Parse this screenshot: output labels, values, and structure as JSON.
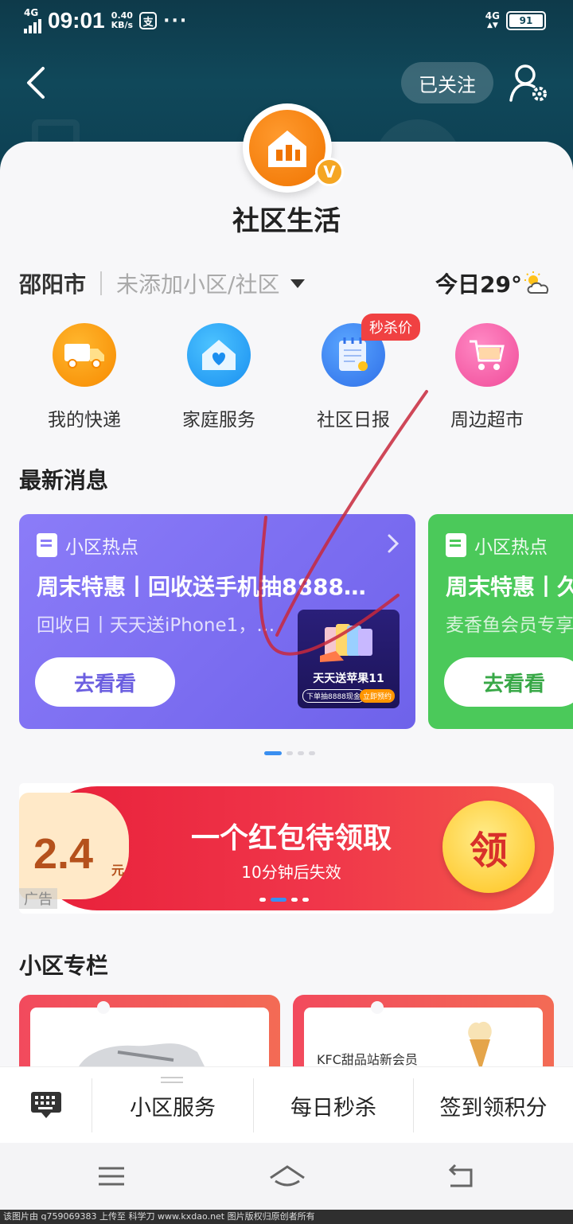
{
  "status_bar": {
    "network_left": "4G",
    "time": "09:01",
    "speed_value": "0.40",
    "speed_unit": "KB/s",
    "pay_icon_char": "支",
    "more": "···",
    "network_right": "4G",
    "battery": "91"
  },
  "header": {
    "follow_label": "已关注"
  },
  "profile": {
    "title": "社区生活"
  },
  "location": {
    "city": "邵阳市",
    "community_placeholder": "未添加小区/社区",
    "weather": "今日29°"
  },
  "services": [
    {
      "label": "我的快递",
      "icon": "truck-icon"
    },
    {
      "label": "家庭服务",
      "icon": "home-heart-icon"
    },
    {
      "label": "社区日报",
      "icon": "calendar-icon"
    },
    {
      "label": "周边超市",
      "icon": "shopping-cart-icon"
    }
  ],
  "badge": "秒杀价",
  "latest": {
    "section_title": "最新消息",
    "cards": [
      {
        "tag": "小区热点",
        "title": "周末特惠丨回收送手机抽8888…",
        "subtitle": "回收日丨天天送iPhone1，…",
        "button": "去看看",
        "promo_title": "天天送苹果11",
        "promo_note": "下单抽8888现金",
        "promo_cta": "立即预约"
      },
      {
        "tag": "小区热点",
        "title": "周末特惠丨久",
        "subtitle": "麦香鱼会员专享",
        "button": "去看看"
      }
    ]
  },
  "red_packet": {
    "amount": "2.4",
    "unit": "元",
    "title": "一个红包待领取",
    "subtitle": "10分钟后失效",
    "claim": "领",
    "ad_tag": "广告"
  },
  "column": {
    "section_title": "小区专栏",
    "cards": [
      {
        "text": ""
      },
      {
        "text": "KFC甜品站新会员"
      }
    ]
  },
  "menu": {
    "items": [
      "小区服务",
      "每日秒杀",
      "签到领积分"
    ]
  },
  "footer_text": "该图片由 q759069383 上传至 科学刀 www.kxdao.net 图片版权归原创者所有"
}
